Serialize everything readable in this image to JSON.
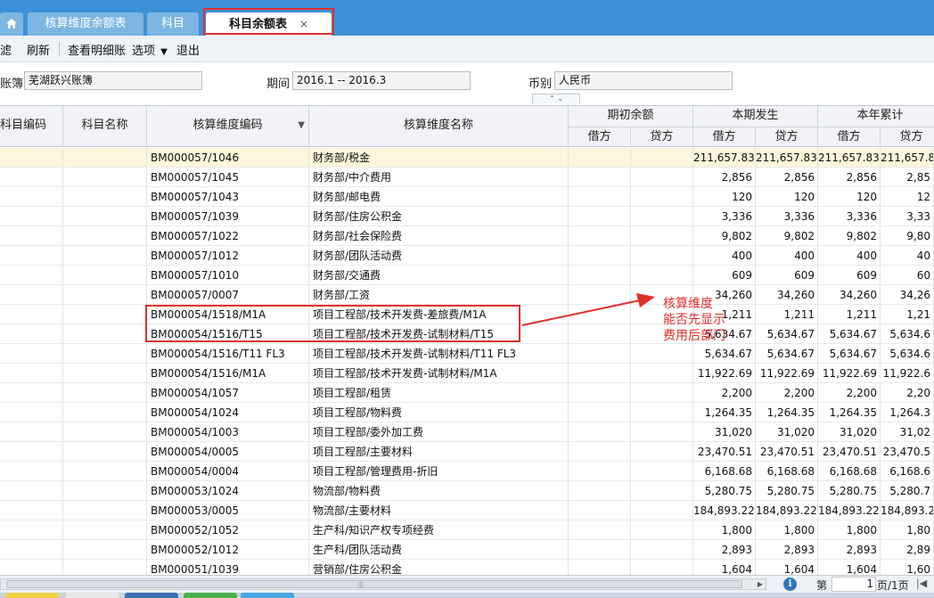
{
  "tabs": [
    {
      "label": ""
    },
    {
      "label": "核算维度余额表"
    },
    {
      "label": "科目"
    },
    {
      "label": "科目余额表",
      "close": "×"
    }
  ],
  "toolbar": {
    "filter_label": "滤",
    "refresh_label": "刷新",
    "detail_label": "查看明细账",
    "options_label": "选项",
    "options_arrow": "▼",
    "exit_label": "退出"
  },
  "filters": {
    "ledger_label": "账簿",
    "ledger_value": "芜湖跃兴账簿",
    "period_label": "期间",
    "period_value": "2016.1 -- 2016.3",
    "currency_label": "币别",
    "currency_value": "人民币",
    "collapse_glyph": "⌃ ⌄"
  },
  "grid": {
    "headers": {
      "acct_code": "科目编码",
      "acct_name": "科目名称",
      "dim_code": "核算维度编码",
      "dim_name": "核算维度名称",
      "opening": "期初余额",
      "current": "本期发生",
      "ytd": "本年累计",
      "debit": "借方",
      "credit": "贷方",
      "sort_arrow": "▼"
    },
    "rows": [
      {
        "code": "BM000057/1046",
        "name": "财务部/税金",
        "cd": "211,657.83",
        "cc": "211,657.83",
        "yd": "211,657.83",
        "yc": "211,657.8"
      },
      {
        "code": "BM000057/1045",
        "name": "财务部/中介费用",
        "cd": "2,856",
        "cc": "2,856",
        "yd": "2,856",
        "yc": "2,85"
      },
      {
        "code": "BM000057/1043",
        "name": "财务部/邮电费",
        "cd": "120",
        "cc": "120",
        "yd": "120",
        "yc": "12"
      },
      {
        "code": "BM000057/1039",
        "name": "财务部/住房公积金",
        "cd": "3,336",
        "cc": "3,336",
        "yd": "3,336",
        "yc": "3,33"
      },
      {
        "code": "BM000057/1022",
        "name": "财务部/社会保险费",
        "cd": "9,802",
        "cc": "9,802",
        "yd": "9,802",
        "yc": "9,80"
      },
      {
        "code": "BM000057/1012",
        "name": "财务部/团队活动费",
        "cd": "400",
        "cc": "400",
        "yd": "400",
        "yc": "40"
      },
      {
        "code": "BM000057/1010",
        "name": "财务部/交通费",
        "cd": "609",
        "cc": "609",
        "yd": "609",
        "yc": "60"
      },
      {
        "code": "BM000057/0007",
        "name": "财务部/工资",
        "cd": "34,260",
        "cc": "34,260",
        "yd": "34,260",
        "yc": "34,26"
      },
      {
        "code": "BM000054/1518/M1A",
        "name": "项目工程部/技术开发费-差旅费/M1A",
        "cd": "1,211",
        "cc": "1,211",
        "yd": "1,211",
        "yc": "1,21"
      },
      {
        "code": "BM000054/1516/T15",
        "name": "项目工程部/技术开发费-试制材料/T15",
        "cd": "5,634.67",
        "cc": "5,634.67",
        "yd": "5,634.67",
        "yc": "5,634.6"
      },
      {
        "code": "BM000054/1516/T11 FL3",
        "name": "项目工程部/技术开发费-试制材料/T11 FL3",
        "cd": "5,634.67",
        "cc": "5,634.67",
        "yd": "5,634.67",
        "yc": "5,634.6"
      },
      {
        "code": "BM000054/1516/M1A",
        "name": "项目工程部/技术开发费-试制材料/M1A",
        "cd": "11,922.69",
        "cc": "11,922.69",
        "yd": "11,922.69",
        "yc": "11,922.6"
      },
      {
        "code": "BM000054/1057",
        "name": "项目工程部/租赁",
        "cd": "2,200",
        "cc": "2,200",
        "yd": "2,200",
        "yc": "2,20"
      },
      {
        "code": "BM000054/1024",
        "name": "项目工程部/物料费",
        "cd": "1,264.35",
        "cc": "1,264.35",
        "yd": "1,264.35",
        "yc": "1,264.3"
      },
      {
        "code": "BM000054/1003",
        "name": "项目工程部/委外加工费",
        "cd": "31,020",
        "cc": "31,020",
        "yd": "31,020",
        "yc": "31,02"
      },
      {
        "code": "BM000054/0005",
        "name": "项目工程部/主要材料",
        "cd": "23,470.51",
        "cc": "23,470.51",
        "yd": "23,470.51",
        "yc": "23,470.5"
      },
      {
        "code": "BM000054/0004",
        "name": "项目工程部/管理费用-折旧",
        "cd": "6,168.68",
        "cc": "6,168.68",
        "yd": "6,168.68",
        "yc": "6,168.6"
      },
      {
        "code": "BM000053/1024",
        "name": "物流部/物料费",
        "cd": "5,280.75",
        "cc": "5,280.75",
        "yd": "5,280.75",
        "yc": "5,280.7"
      },
      {
        "code": "BM000053/0005",
        "name": "物流部/主要材料",
        "cd": "184,893.22",
        "cc": "184,893.22",
        "yd": "184,893.22",
        "yc": "184,893.2"
      },
      {
        "code": "BM000052/1052",
        "name": "生产科/知识产权专项经费",
        "cd": "1,800",
        "cc": "1,800",
        "yd": "1,800",
        "yc": "1,80"
      },
      {
        "code": "BM000052/1012",
        "name": "生产科/团队活动费",
        "cd": "2,893",
        "cc": "2,893",
        "yd": "2,893",
        "yc": "2,89"
      },
      {
        "code": "BM000051/1039",
        "name": "营销部/住房公积金",
        "cd": "1,604",
        "cc": "1,604",
        "yd": "1,604",
        "yc": "1,60"
      }
    ]
  },
  "annotation": {
    "note_line1": "核算维度",
    "note_line2": "能否先显示",
    "note_line3": "费用后部门",
    "color": "#e0302c"
  },
  "status": {
    "page_prefix": "第",
    "page_input": "1",
    "page_suffix": "页/1页",
    "info_icon": "i",
    "nav_first": "|◀"
  },
  "colors": {
    "tabbar": "#3d91d6",
    "selected_row": "#fdf6dc",
    "accent_red": "#e0302c"
  }
}
